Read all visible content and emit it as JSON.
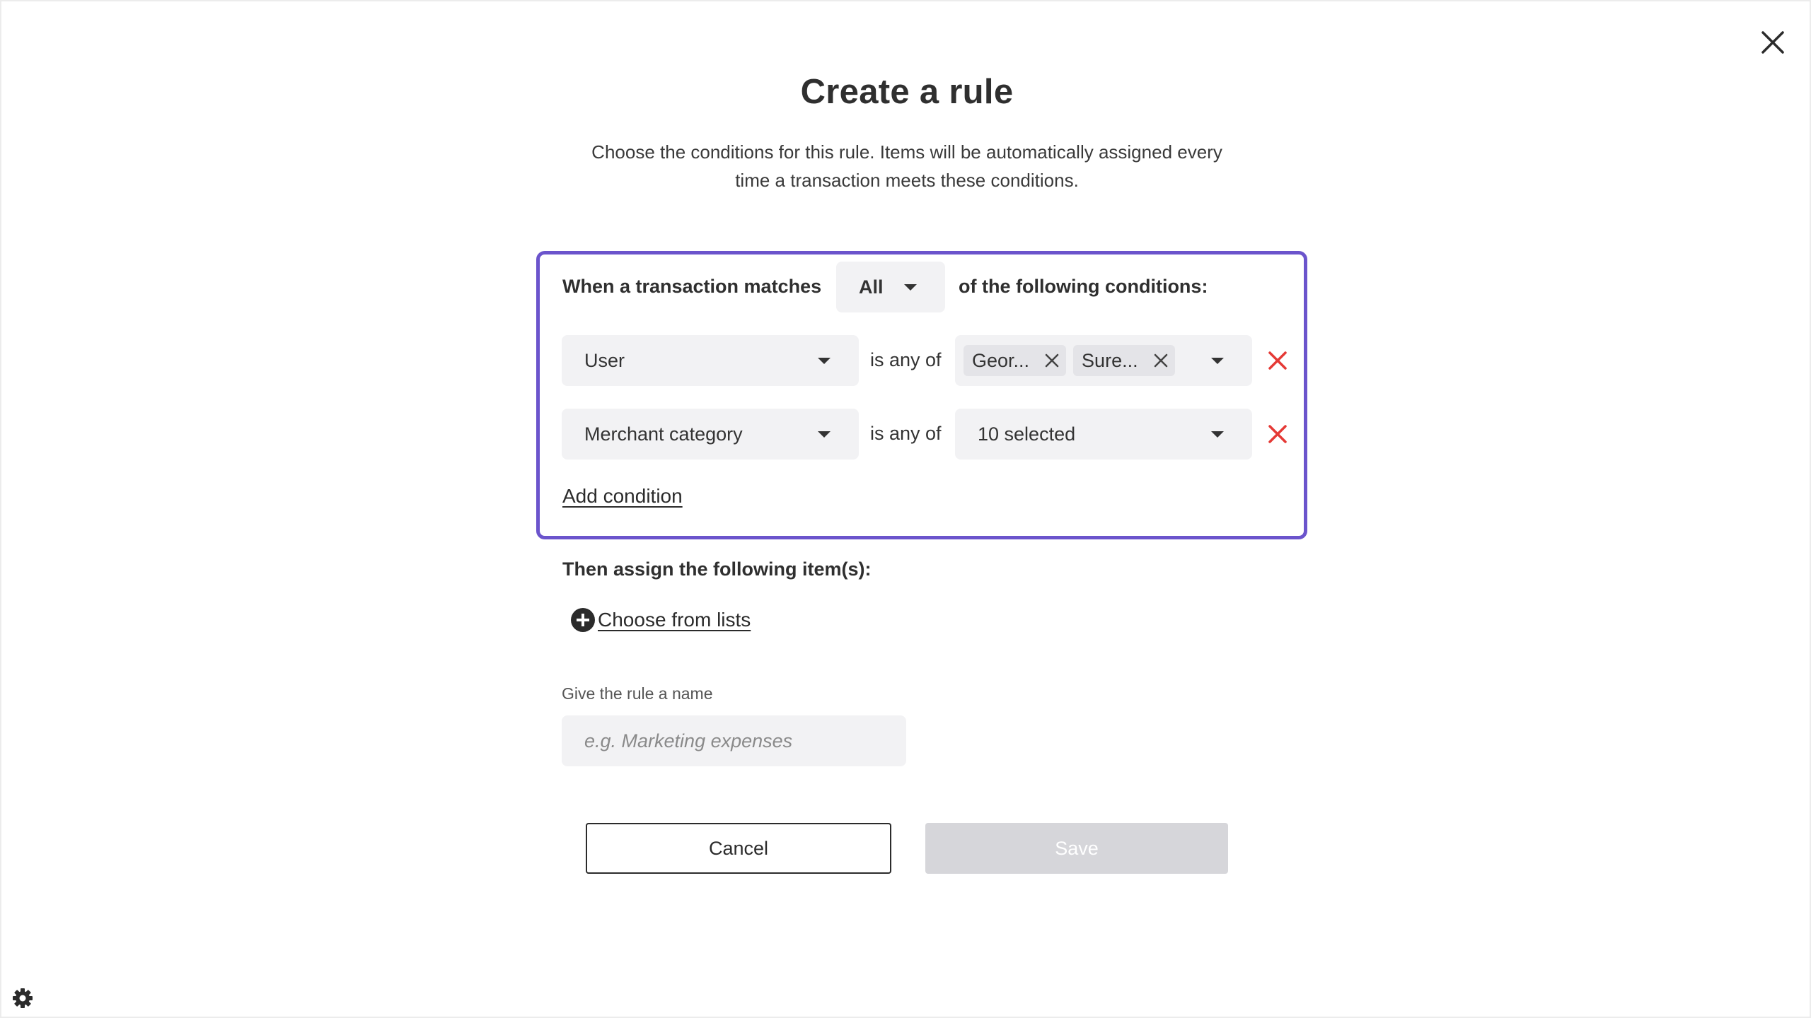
{
  "dialog": {
    "title": "Create a rule",
    "subtitle_line1": "Choose the conditions for this rule. Items will be automatically assigned every",
    "subtitle_line2": "time a transaction meets these conditions."
  },
  "conditions": {
    "prefix": "When a transaction matches",
    "match_mode": "All",
    "suffix": "of the following conditions:",
    "rows": [
      {
        "field": "User",
        "operator": "is any of",
        "chips": [
          "Geor...",
          "Sure..."
        ]
      },
      {
        "field": "Merchant category",
        "operator": "is any of",
        "value": "10 selected"
      }
    ],
    "add_condition_label": "Add condition"
  },
  "assign": {
    "heading": "Then assign the following item(s):",
    "choose_label": "Choose from lists"
  },
  "name_field": {
    "label": "Give the rule a name",
    "placeholder": "e.g. Marketing expenses",
    "value": ""
  },
  "actions": {
    "cancel_label": "Cancel",
    "save_label": "Save",
    "save_disabled": true
  },
  "icons": {
    "close": "close-icon",
    "settings": "gear-icon",
    "remove": "remove-condition-icon",
    "add": "plus-circle-icon"
  },
  "colors": {
    "accent_border": "#6b54cc",
    "remove_red": "#e53935",
    "input_bg": "#f2f2f4",
    "disabled_button": "#d6d6da"
  }
}
